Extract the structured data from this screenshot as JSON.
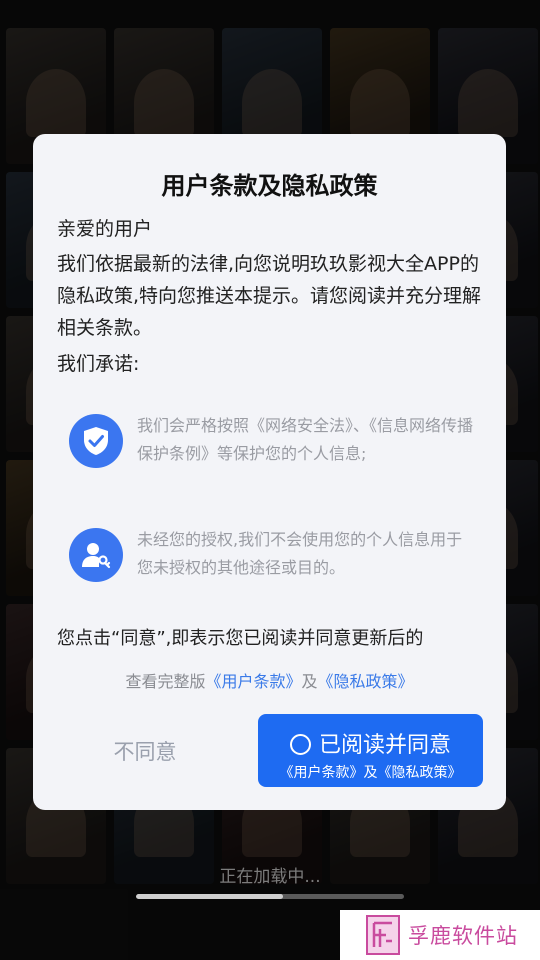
{
  "dialog": {
    "title": "用户条款及隐私政策",
    "greeting": "亲爱的用户",
    "intro": "我们依据最新的法律,向您说明玖玖影视大全APP的隐私政策,特向您推送本提示。请您阅读并充分理解相关条款。",
    "promise_heading": "我们承诺:",
    "promises": [
      {
        "icon": "shield-check-icon",
        "text": "我们会严格按照《网络安全法》、《信息网络传播保护条例》等保护您的个人信息;"
      },
      {
        "icon": "user-key-icon",
        "text": "未经您的授权,我们不会使用您的个人信息用于您未授权的其他途径或目的。"
      }
    ],
    "consent_text": "您点击“同意”,即表示您已阅读并同意更新后的",
    "links": {
      "prefix": "查看完整版",
      "user_terms": "《用户条款》",
      "joiner": "及",
      "privacy_policy": "《隐私政策》"
    },
    "disagree_label": "不同意",
    "agree_label": "已阅读并同意",
    "agree_sublabel": "《用户条款》及《隐私政策》",
    "accent_color": "#1e6bf2"
  },
  "loading": {
    "text": "正在加载中...",
    "progress": 0.55
  },
  "watermark": {
    "text": "孚鹿软件站"
  }
}
